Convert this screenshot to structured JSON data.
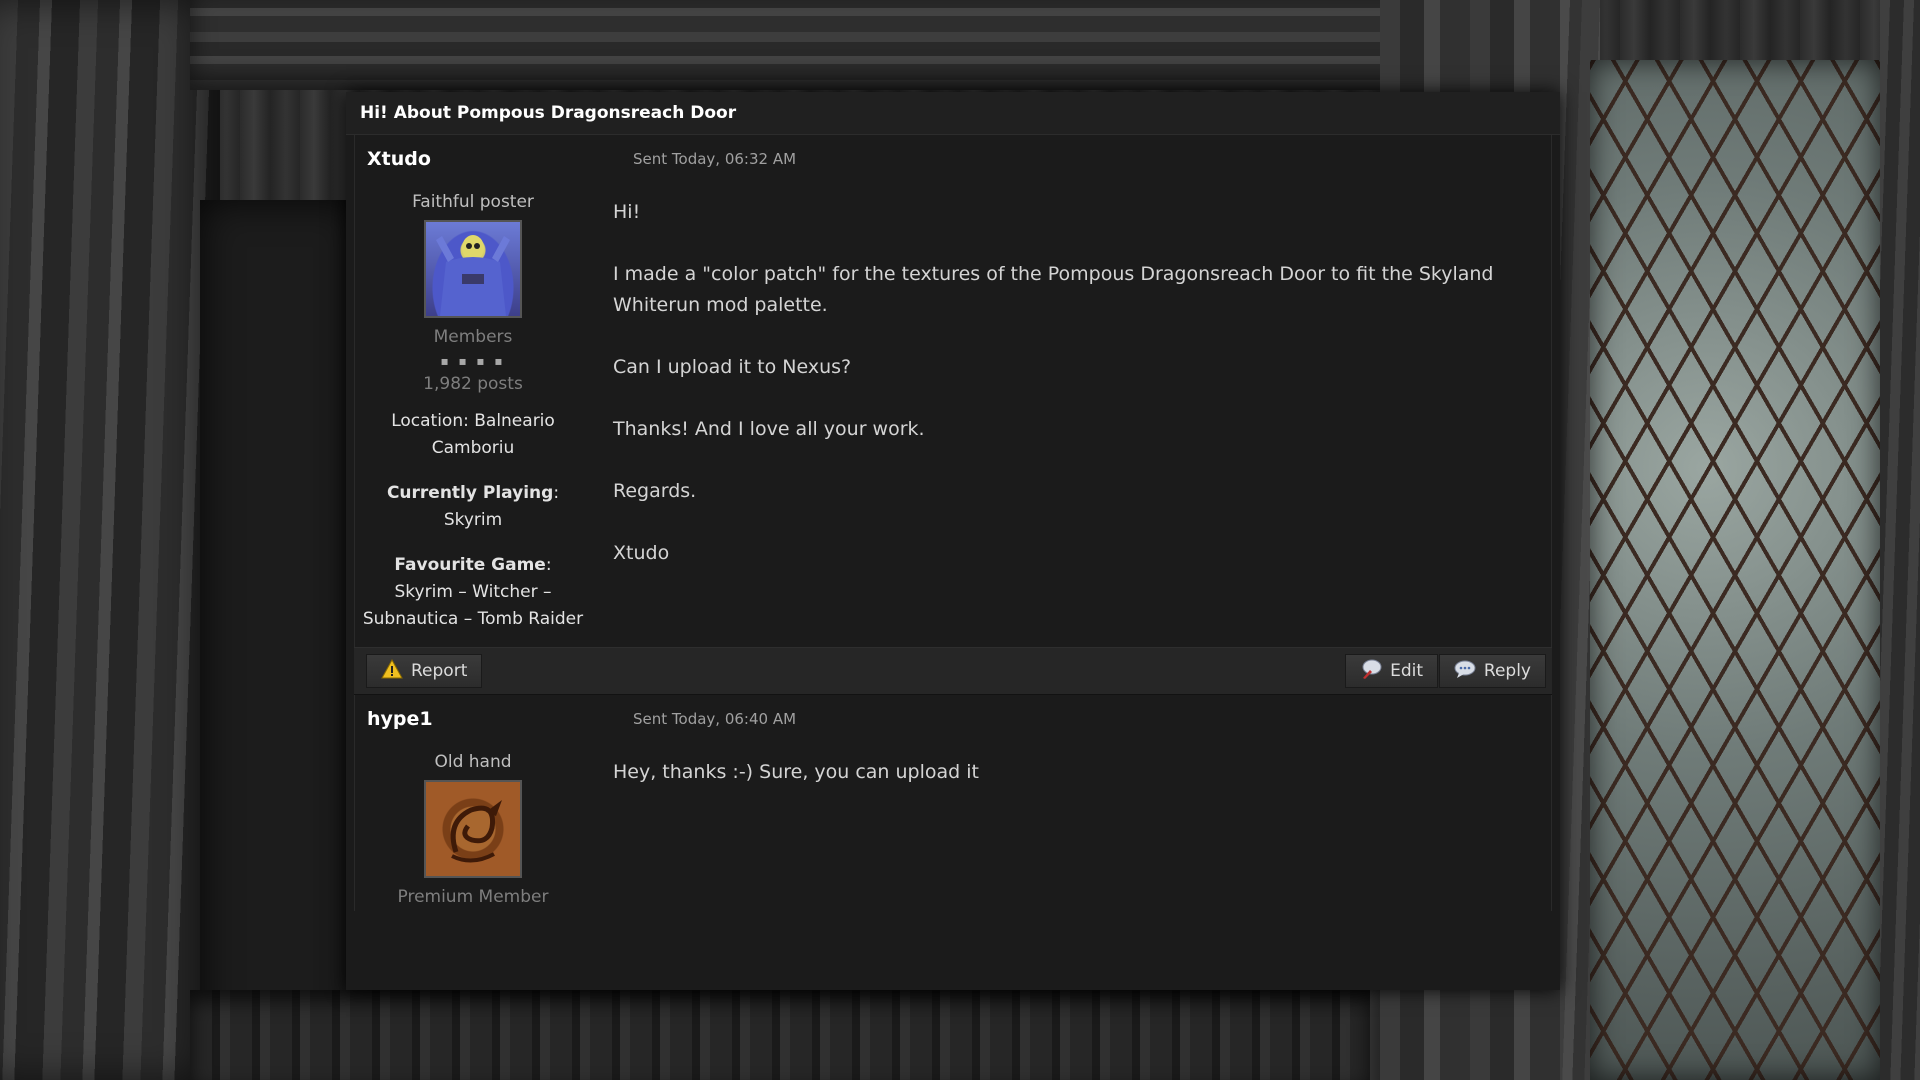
{
  "topic": {
    "title": "Hi! About Pompous Dragonsreach Door"
  },
  "posts": [
    {
      "author": "Xtudo",
      "sent": "Sent Today, 06:32 AM",
      "author_title": "Faithful poster",
      "avatar_icon": "skeletor-avatar-icon",
      "group": "Members",
      "pips": "▪ ▪ ▪ ▪",
      "posts": "1,982 posts",
      "location_label": "Location:",
      "location_value": "Balneario Camboriu",
      "playing_label": "Currently Playing",
      "playing_colon": ":",
      "playing_value": "Skyrim",
      "fav_label": "Favourite Game",
      "fav_colon": ":",
      "fav_value": "Skyrim – Witcher – Subnautica – Tomb Raider",
      "message": [
        "Hi!",
        "I made a \"color patch\" for the textures of the Pompous Dragonsreach Door to fit the Skyland Whiterun mod palette.",
        "Can I upload it to Nexus?",
        "Thanks! And I love all your work.",
        "Regards.",
        "Xtudo"
      ]
    },
    {
      "author": "hype1",
      "sent": "Sent Today, 06:40 AM",
      "author_title": "Old hand",
      "avatar_icon": "dragon-avatar-icon",
      "group": "Premium Member",
      "message": [
        "Hey, thanks :-) Sure, you can upload it"
      ]
    }
  ],
  "footer": {
    "report_label": "Report",
    "edit_label": "Edit",
    "reply_label": "Reply",
    "report_icon": "warning-icon",
    "edit_icon": "edit-icon",
    "reply_icon": "speech-bubble-icon"
  },
  "colors": {
    "panel_bg": "#1b1b1b",
    "footer_bg": "#262626",
    "text_primary": "#d4d4d4",
    "text_muted": "#7e7e7e",
    "warning_yellow": "#f0c020"
  }
}
